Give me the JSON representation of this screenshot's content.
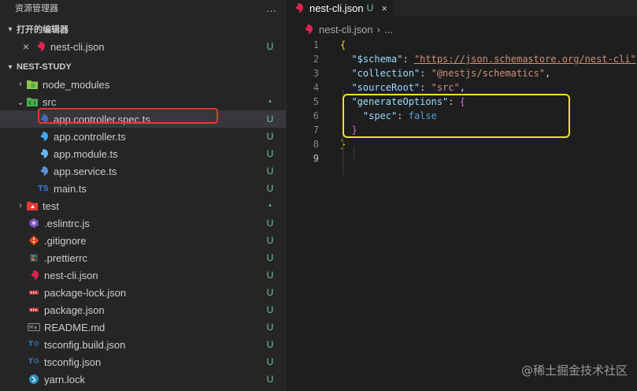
{
  "explorer": {
    "title": "资源管理器",
    "more_icon": "…",
    "open_editors": {
      "label": "打开的编辑器",
      "items": [
        {
          "name": "nest-cli.json",
          "status": "U"
        }
      ]
    },
    "project": {
      "label": "NEST-STUDY",
      "items": [
        {
          "name": "node_modules",
          "icon": "folder-node-icon",
          "status": ""
        },
        {
          "name": "src",
          "icon": "folder-src-icon",
          "status": "•"
        },
        {
          "name": "app.controller.spec.ts",
          "icon": "nest-spec-icon",
          "status": "U"
        },
        {
          "name": "app.controller.ts",
          "icon": "nest-controller-icon",
          "status": "U"
        },
        {
          "name": "app.module.ts",
          "icon": "nest-module-icon",
          "status": "U"
        },
        {
          "name": "app.service.ts",
          "icon": "nest-service-icon",
          "status": "U"
        },
        {
          "name": "main.ts",
          "icon": "typescript-icon",
          "status": "U"
        },
        {
          "name": "test",
          "icon": "folder-test-icon",
          "status": "•"
        },
        {
          "name": ".eslintrc.js",
          "icon": "eslint-icon",
          "status": "U"
        },
        {
          "name": ".gitignore",
          "icon": "git-icon",
          "status": "U"
        },
        {
          "name": ".prettierrc",
          "icon": "prettier-icon",
          "status": "U"
        },
        {
          "name": "nest-cli.json",
          "icon": "nest-icon",
          "status": "U"
        },
        {
          "name": "package-lock.json",
          "icon": "npm-icon",
          "status": "U"
        },
        {
          "name": "package.json",
          "icon": "npm-icon",
          "status": "U"
        },
        {
          "name": "README.md",
          "icon": "markdown-icon",
          "status": "U"
        },
        {
          "name": "tsconfig.build.json",
          "icon": "tsconfig-icon",
          "status": "U"
        },
        {
          "name": "tsconfig.json",
          "icon": "tsconfig-icon",
          "status": "U"
        },
        {
          "name": "yarn.lock",
          "icon": "yarn-icon",
          "status": "U"
        }
      ]
    }
  },
  "editor": {
    "tab": {
      "name": "nest-cli.json",
      "status": "U",
      "close": "×"
    },
    "breadcrumb": {
      "file": "nest-cli.json",
      "sep": "›",
      "rest": "..."
    },
    "lines": [
      {
        "n": "1",
        "open": "{"
      },
      {
        "n": "2",
        "key": "\"$schema\"",
        "value": "\"https://json.schemastore.org/nest-cli\""
      },
      {
        "n": "3",
        "key": "\"collection\"",
        "value": "\"@nestjs/schematics\""
      },
      {
        "n": "4",
        "key": "\"sourceRoot\"",
        "value": "\"src\""
      },
      {
        "n": "5",
        "key": "\"generateOptions\"",
        "open": "{"
      },
      {
        "n": "6",
        "key": "\"spec\"",
        "value": "false"
      },
      {
        "n": "7",
        "close": "}"
      },
      {
        "n": "8",
        "close": "}"
      },
      {
        "n": "9"
      }
    ]
  },
  "watermark": "@稀土掘金技术社区",
  "colors": {
    "badge_untracked": "#73c991",
    "highlight_red": "#e23b2c",
    "highlight_yellow": "#f3e21b",
    "nest_red": "#e0234e",
    "ts_blue": "#3178c6"
  }
}
